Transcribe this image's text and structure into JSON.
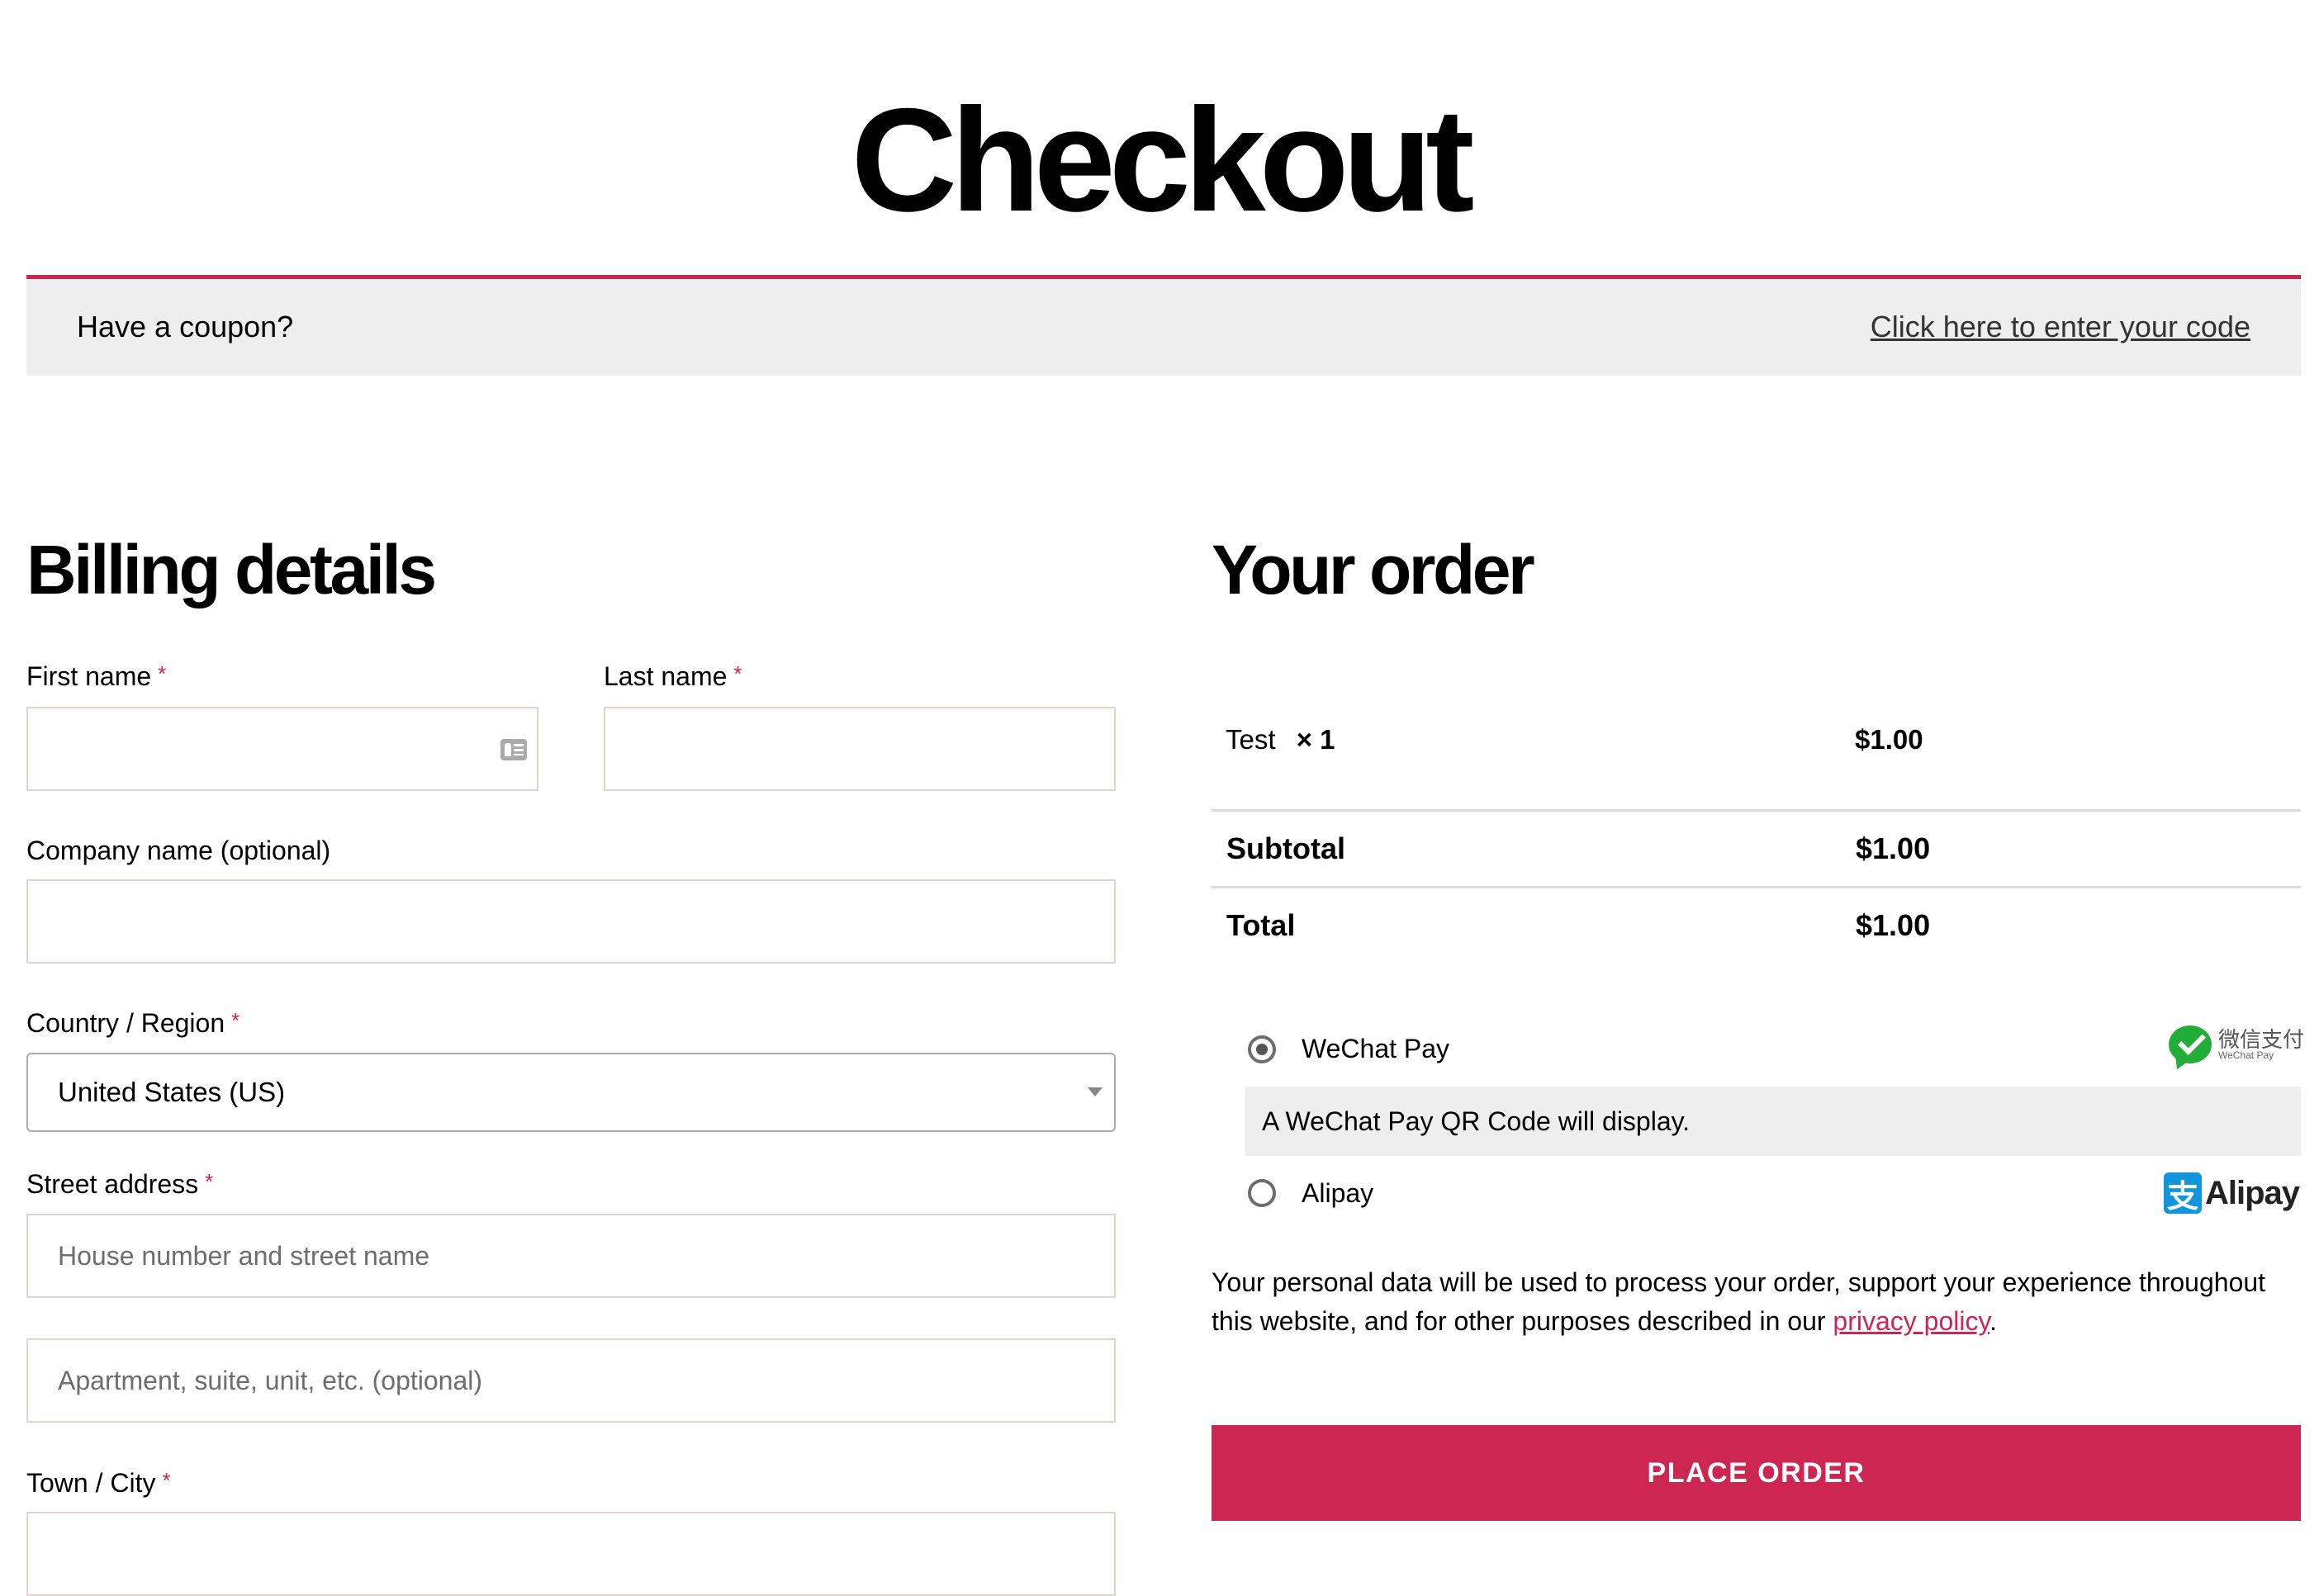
{
  "page": {
    "title": "Checkout"
  },
  "coupon": {
    "prompt": "Have a coupon?",
    "link": "Click here to enter your code"
  },
  "billing": {
    "heading": "Billing details",
    "required_marker": "*",
    "first_name": {
      "label": "First name",
      "value": "",
      "placeholder": ""
    },
    "last_name": {
      "label": "Last name",
      "value": "",
      "placeholder": ""
    },
    "company": {
      "label": "Company name (optional)",
      "value": "",
      "placeholder": ""
    },
    "country": {
      "label": "Country / Region",
      "value": "United States (US)"
    },
    "street": {
      "label": "Street address",
      "line1_placeholder": "House number and street name",
      "line2_placeholder": "Apartment, suite, unit, etc. (optional)"
    },
    "city": {
      "label": "Town / City",
      "value": ""
    }
  },
  "order": {
    "heading": "Your order",
    "items": [
      {
        "name": "Test",
        "quantity": "× 1",
        "price": "$1.00"
      }
    ],
    "subtotal": {
      "label": "Subtotal",
      "value": "$1.00"
    },
    "total": {
      "label": "Total",
      "value": "$1.00"
    }
  },
  "payment": {
    "methods": [
      {
        "label": "WeChat Pay",
        "selected": true,
        "description": "A WeChat Pay QR Code will display.",
        "logo_cn": "微信支付",
        "logo_en": "WeChat Pay",
        "icon": "wechat-pay-logo"
      },
      {
        "label": "Alipay",
        "selected": false,
        "logo_glyph": "支",
        "logo_text": "Alipay",
        "icon": "alipay-logo"
      }
    ]
  },
  "privacy": {
    "text": "Your personal data will be used to process your order, support your experience throughout this website, and for other purposes described in our ",
    "link": "privacy policy",
    "suffix": "."
  },
  "place_order": {
    "label": "PLACE ORDER"
  },
  "colors": {
    "accent": "#cd2653",
    "notice_bg": "#eeeeee",
    "border": "#dcd7ca"
  }
}
